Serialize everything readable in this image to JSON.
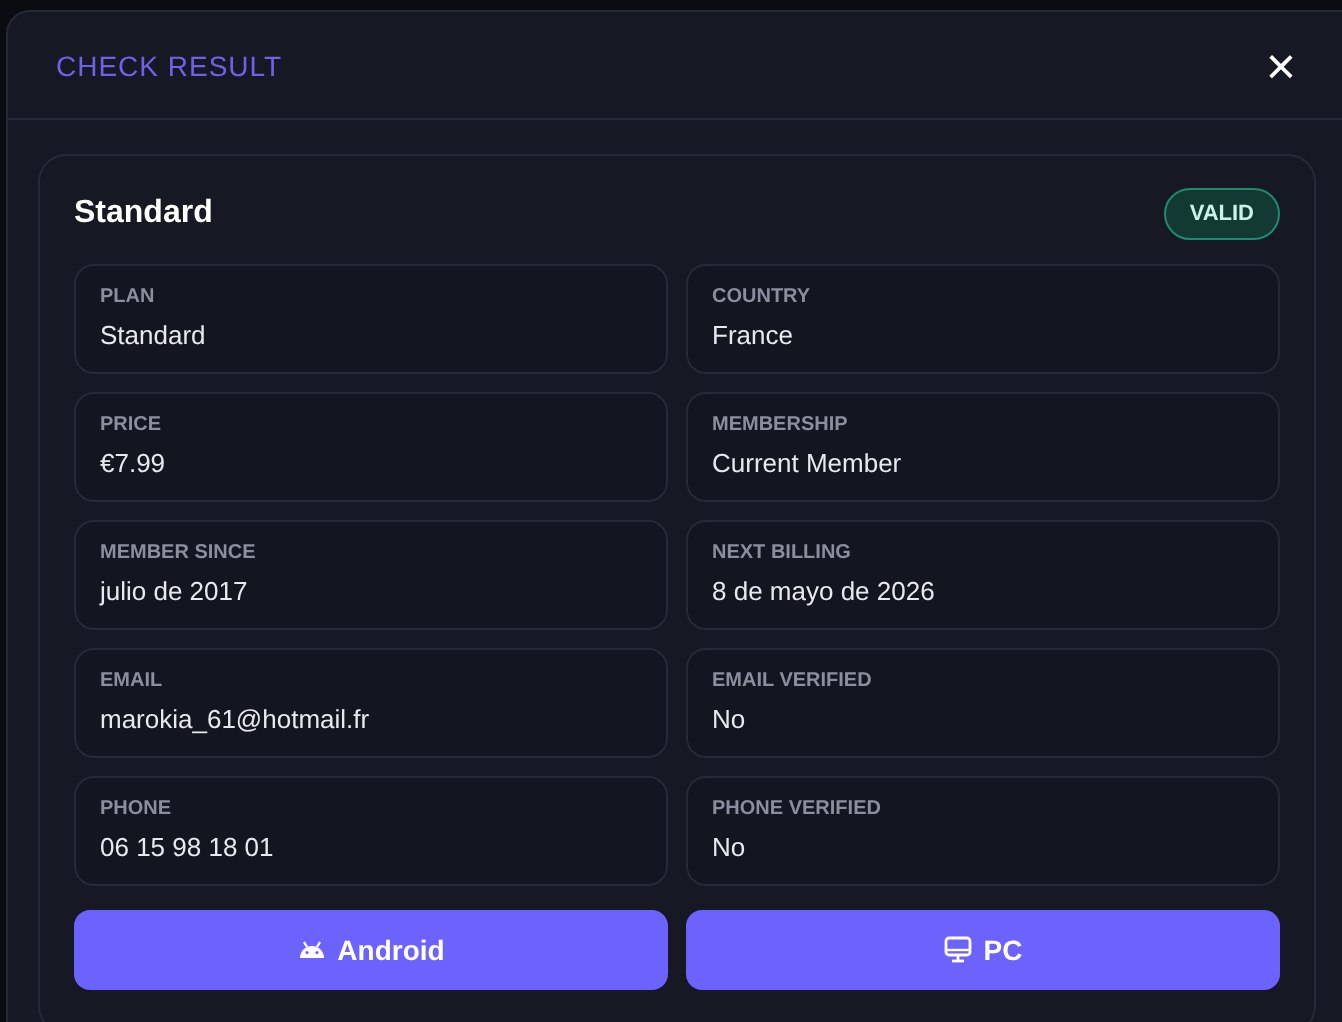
{
  "dialog": {
    "title": "CHECK RESULT",
    "close": "×"
  },
  "card": {
    "title": "Standard",
    "badge": "VALID",
    "fields": [
      {
        "label": "PLAN",
        "value": "Standard"
      },
      {
        "label": "COUNTRY",
        "value": "France"
      },
      {
        "label": "PRICE",
        "value": "€7.99"
      },
      {
        "label": "MEMBERSHIP",
        "value": "Current Member"
      },
      {
        "label": "MEMBER SINCE",
        "value": "julio de 2017"
      },
      {
        "label": "NEXT BILLING",
        "value": "8 de mayo de 2026"
      },
      {
        "label": "EMAIL",
        "value": "marokia_61@hotmail.fr"
      },
      {
        "label": "EMAIL VERIFIED",
        "value": "No"
      },
      {
        "label": "PHONE",
        "value": "06 15 98 18 01"
      },
      {
        "label": "PHONE VERIFIED",
        "value": "No"
      }
    ],
    "buttons": [
      {
        "kind": "android",
        "label": "Android"
      },
      {
        "kind": "pc",
        "label": "PC"
      }
    ]
  }
}
